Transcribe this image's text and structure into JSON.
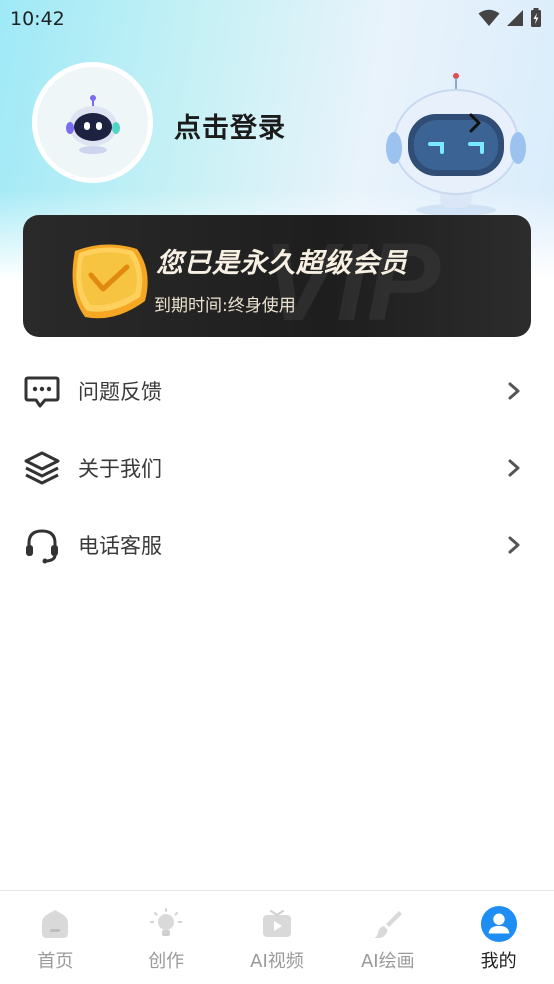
{
  "status_bar": {
    "time": "10:42"
  },
  "profile": {
    "login_label": "点击登录"
  },
  "vip": {
    "title": "您已是永久超级会员",
    "expire_text": "到期时间:终身使用",
    "watermark": "VIP"
  },
  "menu": {
    "items": [
      {
        "label": "问题反馈",
        "icon": "feedback-icon"
      },
      {
        "label": "关于我们",
        "icon": "layers-icon"
      },
      {
        "label": "电话客服",
        "icon": "headset-icon"
      }
    ]
  },
  "bottom_nav": {
    "items": [
      {
        "label": "首页",
        "icon": "home-icon",
        "active": false
      },
      {
        "label": "创作",
        "icon": "lightbulb-icon",
        "active": false
      },
      {
        "label": "AI视频",
        "icon": "video-icon",
        "active": false
      },
      {
        "label": "AI绘画",
        "icon": "brush-icon",
        "active": false
      },
      {
        "label": "我的",
        "icon": "profile-icon",
        "active": true
      }
    ]
  },
  "colors": {
    "accent": "#1e8ef5",
    "header_gradient_start": "#9fe9f7",
    "vip_card": "#222222",
    "gold": "#f5b731"
  }
}
